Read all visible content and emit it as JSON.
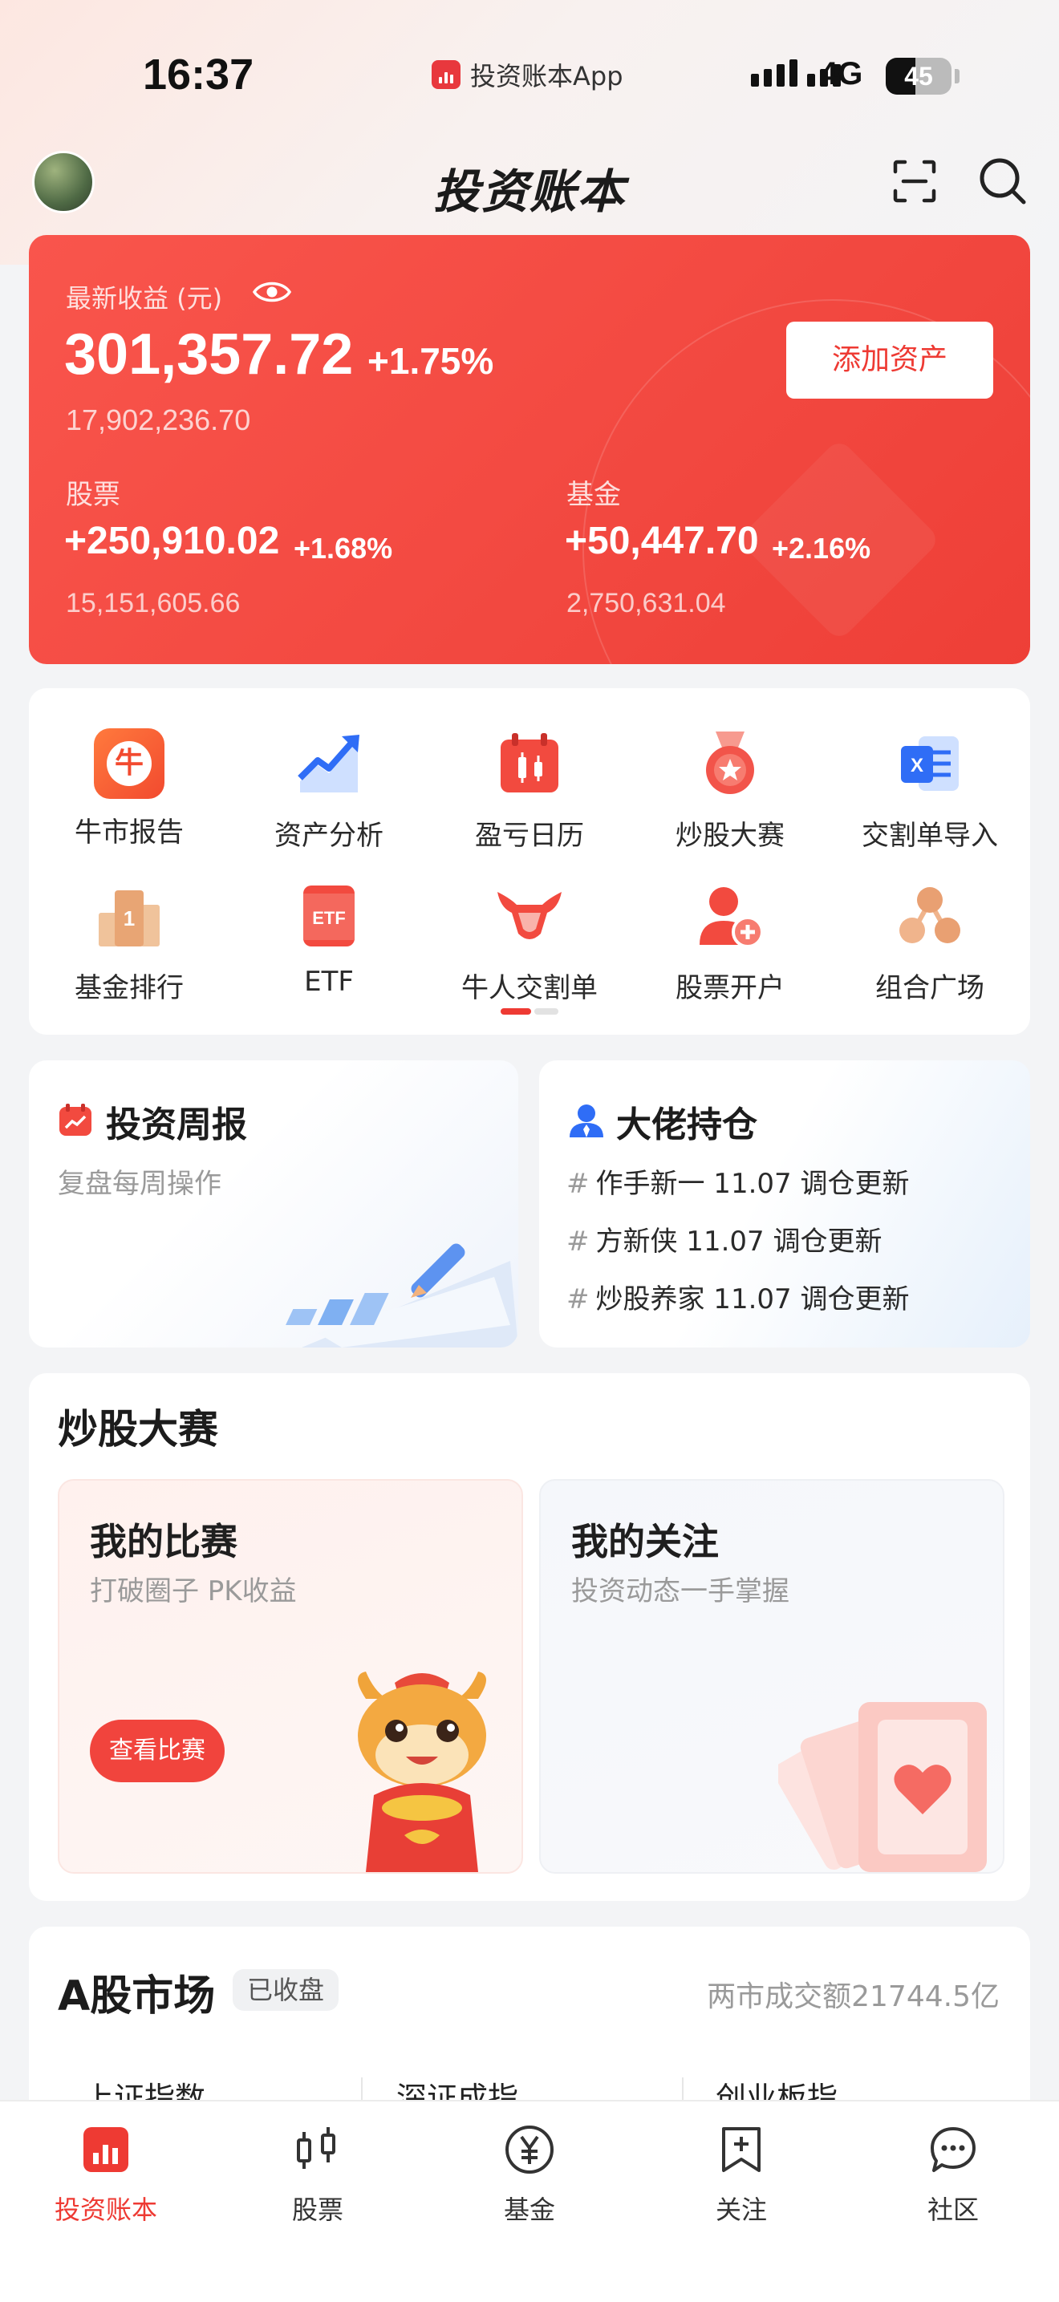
{
  "status_bar": {
    "time": "16:37",
    "back_app": "投资账本App",
    "network": "4G",
    "battery": "45",
    "battery_level": 0.45
  },
  "header": {
    "title": "投资账本",
    "scan_icon": "scan-icon",
    "search_icon": "search-icon"
  },
  "summary": {
    "label": "最新收益 (元)",
    "total_profit": "301,357.72",
    "total_pct": "+1.75%",
    "total_assets": "17,902,236.70",
    "add_button": "添加资产",
    "stock": {
      "label": "股票",
      "profit": "+250,910.02",
      "pct": "+1.68%",
      "assets": "15,151,605.66"
    },
    "fund": {
      "label": "基金",
      "profit": "+50,447.70",
      "pct": "+2.16%",
      "assets": "2,750,631.04"
    }
  },
  "quick_grid": [
    {
      "label": "牛市报告",
      "icon": "bull-report-icon"
    },
    {
      "label": "资产分析",
      "icon": "asset-analysis-icon"
    },
    {
      "label": "盈亏日历",
      "icon": "pnl-calendar-icon"
    },
    {
      "label": "炒股大赛",
      "icon": "contest-medal-icon"
    },
    {
      "label": "交割单导入",
      "icon": "excel-import-icon"
    },
    {
      "label": "基金排行",
      "icon": "fund-ranking-icon"
    },
    {
      "label": "ETF",
      "icon": "etf-icon"
    },
    {
      "label": "牛人交割单",
      "icon": "bull-trader-icon"
    },
    {
      "label": "股票开户",
      "icon": "open-account-icon"
    },
    {
      "label": "组合广场",
      "icon": "portfolio-square-icon"
    }
  ],
  "weekly": {
    "title": "投资周报",
    "subtitle": "复盘每周操作"
  },
  "holdings": {
    "title": "大佬持仓",
    "items": [
      "作手新一 11.07 调仓更新",
      "方新侠 11.07 调仓更新",
      "炒股养家 11.07 调仓更新"
    ]
  },
  "contest": {
    "title": "炒股大赛",
    "my_contest": {
      "title": "我的比赛",
      "subtitle": "打破圈子 PK收益",
      "button": "查看比赛"
    },
    "my_follow": {
      "title": "我的关注",
      "subtitle": "投资动态一手掌握"
    }
  },
  "market": {
    "title": "A股市场",
    "status": "已收盘",
    "turnover": "两市成交额21744.5亿",
    "indices": [
      "上证指数",
      "深证成指",
      "创业板指"
    ]
  },
  "tabbar": [
    {
      "label": "投资账本",
      "icon": "ledger-icon",
      "active": true
    },
    {
      "label": "股票",
      "icon": "stock-candle-icon",
      "active": false
    },
    {
      "label": "基金",
      "icon": "fund-yen-icon",
      "active": false
    },
    {
      "label": "关注",
      "icon": "follow-bookmark-icon",
      "active": false
    },
    {
      "label": "社区",
      "icon": "community-chat-icon",
      "active": false
    }
  ],
  "colors": {
    "accent": "#ee3a33",
    "card_red": "#f24840",
    "background": "#f3f4f6"
  }
}
